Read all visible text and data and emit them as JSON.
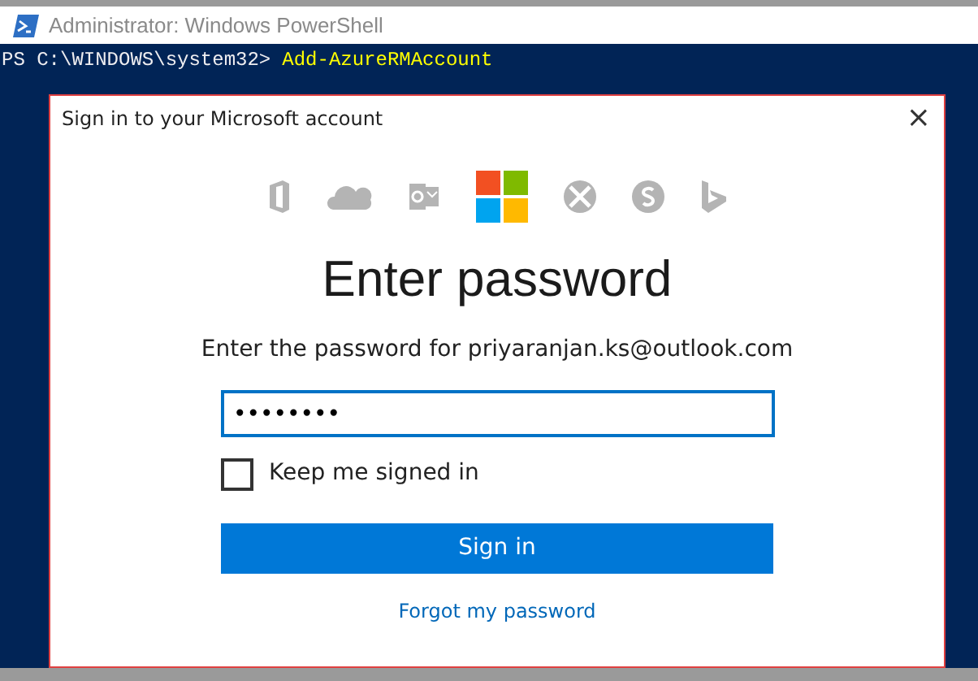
{
  "window": {
    "title": "Administrator: Windows PowerShell"
  },
  "console": {
    "prompt": "PS C:\\WINDOWS\\system32>",
    "command": "Add-AzureRMAccount"
  },
  "dialog": {
    "title": "Sign in to your Microsoft account",
    "close": "×",
    "heading": "Enter password",
    "instruction": "Enter the password for priyaranjan.ks@outlook.com",
    "password": {
      "value": "••••••••"
    },
    "keep_signed_in": {
      "label": "Keep me signed in",
      "checked": false
    },
    "button": "Sign in",
    "link": "Forgot my password"
  }
}
